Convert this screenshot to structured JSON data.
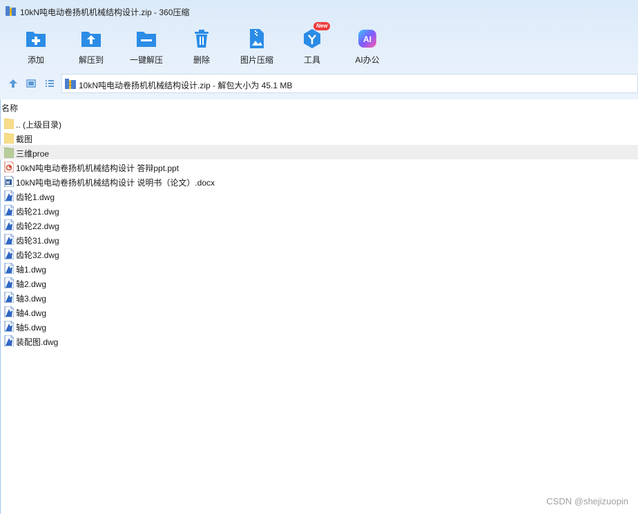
{
  "window": {
    "title": "10kN吨电动卷扬机机械结构设计.zip - 360压缩",
    "icon": "zip-archive-icon"
  },
  "toolbar": [
    {
      "name": "add",
      "label": "添加",
      "icon": "add-folder-icon"
    },
    {
      "name": "extract-to",
      "label": "解压到",
      "icon": "extract-folder-icon"
    },
    {
      "name": "one-click-extract",
      "label": "一键解压",
      "icon": "one-click-extract-icon"
    },
    {
      "name": "delete",
      "label": "删除",
      "icon": "trash-icon"
    },
    {
      "name": "image-compress",
      "label": "图片压缩",
      "icon": "image-compress-icon"
    },
    {
      "name": "tools",
      "label": "工具",
      "icon": "tools-icon",
      "badge": "New"
    },
    {
      "name": "ai-office",
      "label": "AI办公",
      "icon": "ai-office-icon",
      "badge_text": "AI"
    }
  ],
  "address": {
    "text": "10kN吨电动卷扬机机械结构设计.zip - 解包大小为 45.1 MB"
  },
  "columns": {
    "name": "名称"
  },
  "files": [
    {
      "name": ".. (上级目录)",
      "type": "folder"
    },
    {
      "name": "截图",
      "type": "folder"
    },
    {
      "name": "三维proe",
      "type": "folder-green",
      "selected": true
    },
    {
      "name": "10kN吨电动卷扬机机械结构设计 答辩ppt.ppt",
      "type": "ppt"
    },
    {
      "name": "10kN吨电动卷扬机机械结构设计 说明书（论文）.docx",
      "type": "docx"
    },
    {
      "name": "齿轮1.dwg",
      "type": "dwg"
    },
    {
      "name": "齿轮21.dwg",
      "type": "dwg"
    },
    {
      "name": "齿轮22.dwg",
      "type": "dwg"
    },
    {
      "name": "齿轮31.dwg",
      "type": "dwg"
    },
    {
      "name": "齿轮32.dwg",
      "type": "dwg"
    },
    {
      "name": "轴1.dwg",
      "type": "dwg"
    },
    {
      "name": "轴2.dwg",
      "type": "dwg"
    },
    {
      "name": "轴3.dwg",
      "type": "dwg"
    },
    {
      "name": "轴4.dwg",
      "type": "dwg"
    },
    {
      "name": "轴5.dwg",
      "type": "dwg"
    },
    {
      "name": "装配图.dwg",
      "type": "dwg"
    }
  ],
  "watermark": "CSDN @shejizuopin",
  "colors": {
    "accent": "#2b8ce6",
    "toolbar_bg": "#dbeaf9",
    "selected_row": "#eeeeee"
  }
}
